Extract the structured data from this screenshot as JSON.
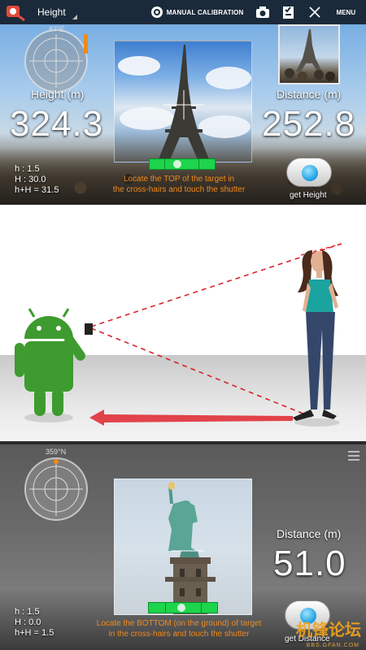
{
  "topbar": {
    "mode": "Height",
    "calibration_label": "MANUAL CALIBRATION",
    "menu_label": "MENU"
  },
  "top_panel": {
    "compass_heading": "87°E",
    "height_label": "Height (m)",
    "height_value": "324.3",
    "distance_label": "Distance (m)",
    "distance_value": "252.8",
    "h": "h : 1.5",
    "H": "H : 30.0",
    "hH": "h+H = 31.5",
    "hint_line1": "Locate the TOP of the target in",
    "hint_line2": "the cross-hairs and touch the shutter",
    "shutter_label": "get Height"
  },
  "bottom_panel": {
    "compass_heading": "359°N",
    "distance_label": "Distance (m)",
    "distance_value": "51.0",
    "h": "h : 1.5",
    "H": "H : 0.0",
    "hH": "h+H = 1.5",
    "hint_line1": "Locate the BOTTOM (on the ground) of target",
    "hint_line2": "in the cross-hairs and touch the shutter",
    "shutter_label": "get Distance",
    "watermark": "机锋论坛",
    "watermark_sub": "BBS.GFAN.COM"
  },
  "colors": {
    "accent_orange": "#f08a1c",
    "level_green": "#1ed44c",
    "sight_line_red": "#d8232a"
  }
}
